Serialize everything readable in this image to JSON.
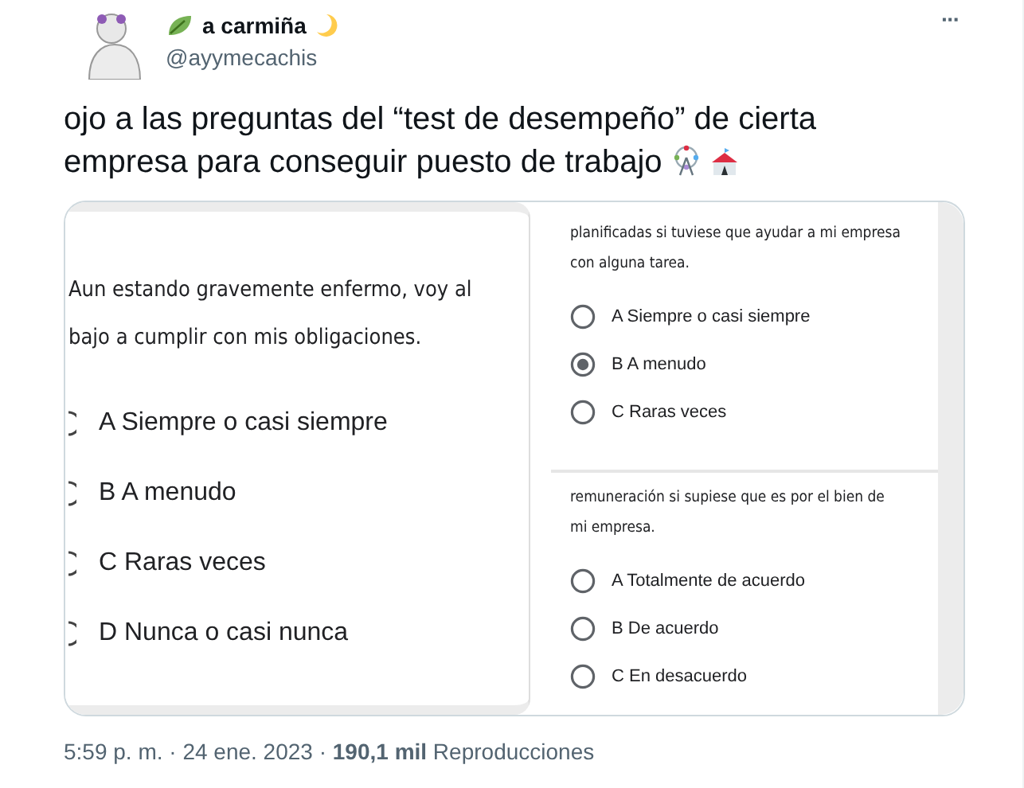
{
  "author": {
    "name": "a carmiña",
    "handle": "@ayymecachis"
  },
  "more": "···",
  "tweet_text": "ojo a las preguntas del “test de desempeño” de cierta empresa para conseguir puesto de trabajo",
  "media": [
    {
      "kind": "large",
      "question_lines": [
        "Aun estando gravemente enfermo, voy al",
        "bajo a cumplir con mis obligaciones."
      ],
      "options": [
        {
          "label": "A Siempre o casi siempre",
          "selected": false
        },
        {
          "label": "B A menudo",
          "selected": false
        },
        {
          "label": "C Raras veces",
          "selected": false
        },
        {
          "label": "D Nunca o casi nunca",
          "selected": false
        }
      ]
    },
    {
      "kind": "small",
      "question_lines": [
        "planificadas si tuviese que ayudar a mi empresa",
        "con alguna tarea."
      ],
      "options": [
        {
          "label": "A Siempre o casi siempre",
          "selected": false
        },
        {
          "label": "B A menudo",
          "selected": true
        },
        {
          "label": "C Raras veces",
          "selected": false
        }
      ]
    },
    {
      "kind": "small",
      "question_lines": [
        "remuneración si supiese que es por el bien de",
        "mi empresa."
      ],
      "options": [
        {
          "label": "A Totalmente de acuerdo",
          "selected": false
        },
        {
          "label": "B De acuerdo",
          "selected": false
        },
        {
          "label": "C En desacuerdo",
          "selected": false
        }
      ]
    }
  ],
  "footer": "5:59 p. m. · 24 ene. 2023 · **190,1 mil** Reproducciones"
}
